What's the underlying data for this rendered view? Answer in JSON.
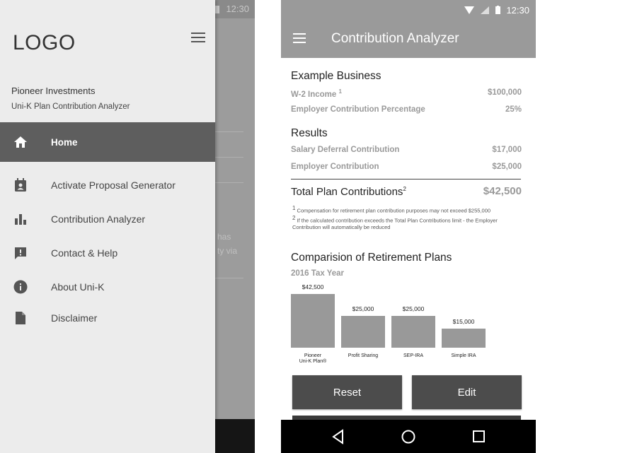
{
  "colors": {
    "drawer_active_bg": "#5e5e5e",
    "app_bar": "#9a9a9a",
    "button_bg": "#4c4c4c",
    "bar_fill": "#999999"
  },
  "left": {
    "status": {
      "time": "12:30"
    },
    "drawer": {
      "logo": "LOGO",
      "org": "Pioneer Investments",
      "subtitle": "Uni-K Plan Contribution Analyzer",
      "items": [
        {
          "label": "Home",
          "icon": "home-icon",
          "active": true
        },
        {
          "label": "Activate Proposal Generator",
          "icon": "calendar-person-icon"
        },
        {
          "label": "Contribution Analyzer",
          "icon": "bar-chart-icon"
        },
        {
          "label": "Contact & Help",
          "icon": "feedback-icon"
        },
        {
          "label": "About Uni-K",
          "icon": "info-icon"
        },
        {
          "label": "Disclaimer",
          "icon": "document-icon"
        }
      ]
    },
    "background_snippets": [
      "has",
      "ty via"
    ]
  },
  "right": {
    "status": {
      "time": "12:30"
    },
    "title": "Contribution Analyzer",
    "example": {
      "heading": "Example Business",
      "w2_label": "W-2 Income",
      "w2_sup": "1",
      "w2_value": "$100,000",
      "pct_label": "Employer Contribution Percentage",
      "pct_value": "25%"
    },
    "results": {
      "heading": "Results",
      "deferral_label": "Salary Deferral Contribution",
      "deferral_value": "$17,000",
      "employer_label": "Employer Contribution",
      "employer_value": "$25,000",
      "total_label": "Total Plan Contributions",
      "total_sup": "2",
      "total_value": "$42,500"
    },
    "footnotes": {
      "f1_num": "1",
      "f1": "Compensation for retirement plan contribution purposes may not exceed $255,000",
      "f2_num": "2",
      "f2": "If the calculated contribution exceeds the Total Plan Contributions limit - the Employer Contribution will automatically be reduced"
    },
    "comparison": {
      "heading": "Comparision of Retirement Plans",
      "subheading": "2016 Tax Year"
    },
    "buttons": {
      "reset": "Reset",
      "edit": "Edit"
    }
  },
  "chart_data": {
    "type": "bar",
    "categories": [
      "Pioneer\nUni-K Plan®",
      "Profit Sharing",
      "SEP-IRA",
      "Simple IRA"
    ],
    "values": [
      42500,
      25000,
      25000,
      15000
    ],
    "value_labels": [
      "$42,500",
      "$25,000",
      "$25,000",
      "$15,000"
    ],
    "ylim": [
      0,
      42500
    ]
  }
}
